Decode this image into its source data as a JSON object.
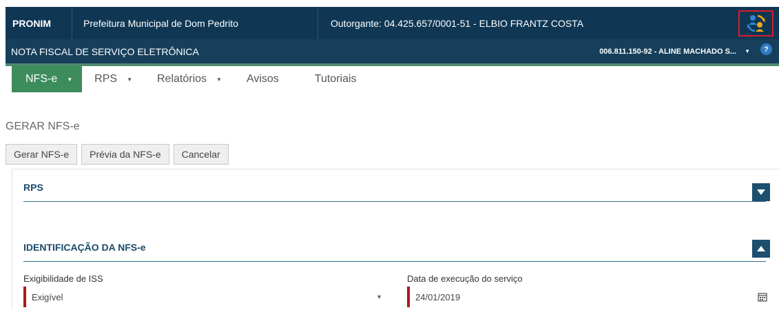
{
  "header": {
    "brand": "PRONIM",
    "municipality": "Prefeitura Municipal de Dom Pedrito",
    "grantor": "Outorgante: 04.425.657/0001-51 - ELBIO FRANTZ COSTA",
    "switch_icon": "refresh-users-icon"
  },
  "subheader": {
    "system_title": "NOTA FISCAL DE SERVIÇO ELETRÔNICA",
    "user": "006.811.150-92 - ALINE MACHADO S...",
    "help": "?"
  },
  "nav": {
    "items": [
      {
        "label": "NFS-e"
      },
      {
        "label": "RPS"
      },
      {
        "label": "Relatórios"
      },
      {
        "label": "Avisos"
      },
      {
        "label": "Tutoriais"
      }
    ]
  },
  "page": {
    "title": "GERAR NFS-e",
    "buttons": {
      "generate": "Gerar NFS-e",
      "preview": "Prévia da NFS-e",
      "cancel": "Cancelar"
    },
    "sections": {
      "rps": "RPS",
      "identification": "IDENTIFICAÇÃO DA NFS-e"
    },
    "fields": {
      "iss_label": "Exigibilidade de ISS",
      "iss_value": "Exigível",
      "date_label": "Data de execução do serviço",
      "date_value": "24/01/2019"
    }
  },
  "colors": {
    "topbar": "#0f3754",
    "subbar": "#163f5c",
    "active_tab": "#3d8c5c",
    "required_marker": "#b3141c",
    "highlight_box": "#d81e2a"
  }
}
